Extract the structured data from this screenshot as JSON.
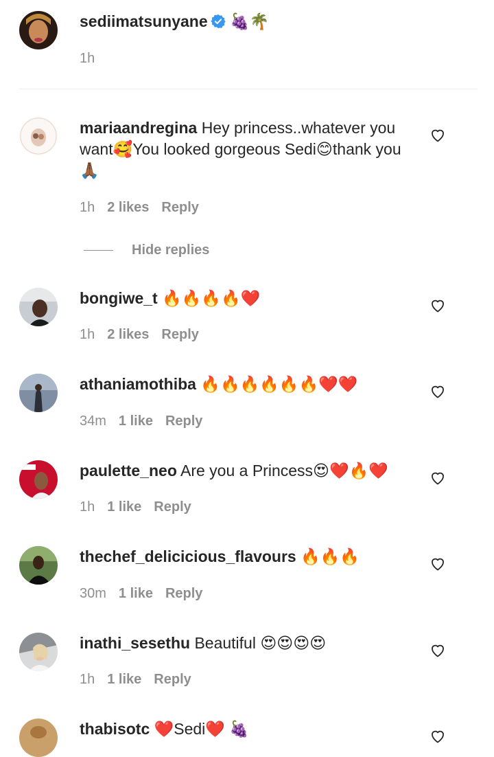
{
  "caption": {
    "username": "sediimatsunyane",
    "verified": true,
    "text": "🍇🌴",
    "time": "1h"
  },
  "comments": [
    {
      "username": "mariaandregina",
      "text": "Hey princess..whatever you want🥰You looked gorgeous Sedi😊thank you 🙏🏾",
      "time": "1h",
      "likes": "2 likes",
      "reply": "Reply"
    }
  ],
  "hide_replies_label": "Hide replies",
  "replies": [
    {
      "username": "bongiwe_t",
      "text": "🔥🔥🔥🔥❤️",
      "time": "1h",
      "likes": "2 likes",
      "reply": "Reply"
    },
    {
      "username": "athaniamothiba",
      "text": "🔥🔥🔥🔥🔥🔥❤️❤️",
      "time": "34m",
      "likes": "1 like",
      "reply": "Reply"
    },
    {
      "username": "paulette_neo",
      "text": "Are you a Princess😍❤️🔥❤️",
      "time": "1h",
      "likes": "1 like",
      "reply": "Reply"
    },
    {
      "username": "thechef_delicicious_flavours",
      "text": "🔥🔥🔥",
      "time": "30m",
      "likes": "1 like",
      "reply": "Reply"
    },
    {
      "username": "inathi_sesethu",
      "text": "Beautiful 😍😍😍😍",
      "time": "1h",
      "likes": "1 like",
      "reply": "Reply"
    },
    {
      "username": "thabisotc",
      "text": "❤️Sedi❤️ 🍇",
      "time": "",
      "likes": "",
      "reply": ""
    }
  ],
  "colors": {
    "text": "#262626",
    "secondary": "#8e8e8e",
    "verified": "#3897f0",
    "divider": "#efefef"
  }
}
